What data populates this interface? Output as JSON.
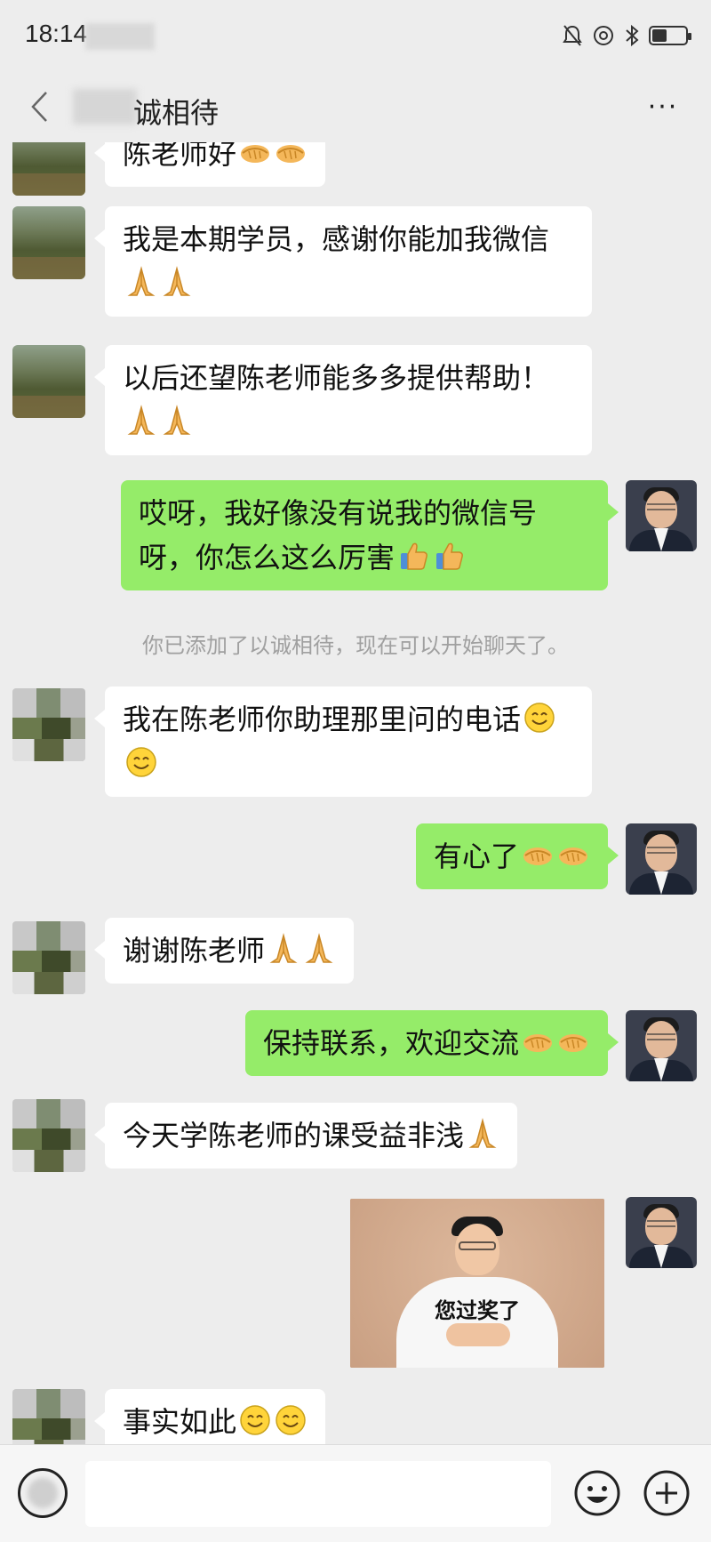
{
  "status_bar": {
    "time": "18:14"
  },
  "nav": {
    "title": "诚相待",
    "more": "···"
  },
  "messages": [
    {
      "side": "in",
      "text": "陈老师好",
      "emojis": [
        "handshake-emoji",
        "handshake-emoji"
      ]
    },
    {
      "side": "in",
      "text": "我是本期学员，感谢你能加我微信",
      "emojis": [
        "pray-emoji",
        "pray-emoji"
      ]
    },
    {
      "side": "in",
      "text": "以后还望陈老师能多多提供帮助！",
      "emojis": [
        "pray-emoji",
        "pray-emoji"
      ]
    },
    {
      "side": "out",
      "text": "哎呀，我好像没有说我的微信号呀，你怎么这么厉害",
      "emojis": [
        "thumbs-up-emoji",
        "thumbs-up-emoji"
      ]
    },
    {
      "side": "in",
      "text": "我在陈老师你助理那里问的电话",
      "emojis": [
        "smile-emoji",
        "smile-emoji"
      ]
    },
    {
      "side": "out",
      "text": "有心了",
      "emojis": [
        "handshake-emoji",
        "handshake-emoji"
      ]
    },
    {
      "side": "in",
      "text": "谢谢陈老师",
      "emojis": [
        "pray-emoji",
        "pray-emoji"
      ]
    },
    {
      "side": "out",
      "text": "保持联系，欢迎交流",
      "emojis": [
        "handshake-emoji",
        "handshake-emoji"
      ]
    },
    {
      "side": "in",
      "text": "今天学陈老师的课受益非浅",
      "emojis": [
        "pray-emoji"
      ]
    },
    {
      "side": "out",
      "type": "sticker",
      "sticker_caption": "您过奖了"
    },
    {
      "side": "in",
      "text": "事实如此",
      "emojis": [
        "smile-emoji",
        "smile-emoji"
      ]
    }
  ],
  "system_note": "你已添加了以诚相待，现在可以开始聊天了。",
  "input_bar": {
    "placeholder": ""
  },
  "colors": {
    "background": "#ededed",
    "incoming_bubble": "#ffffff",
    "outgoing_bubble": "#95ec69"
  }
}
